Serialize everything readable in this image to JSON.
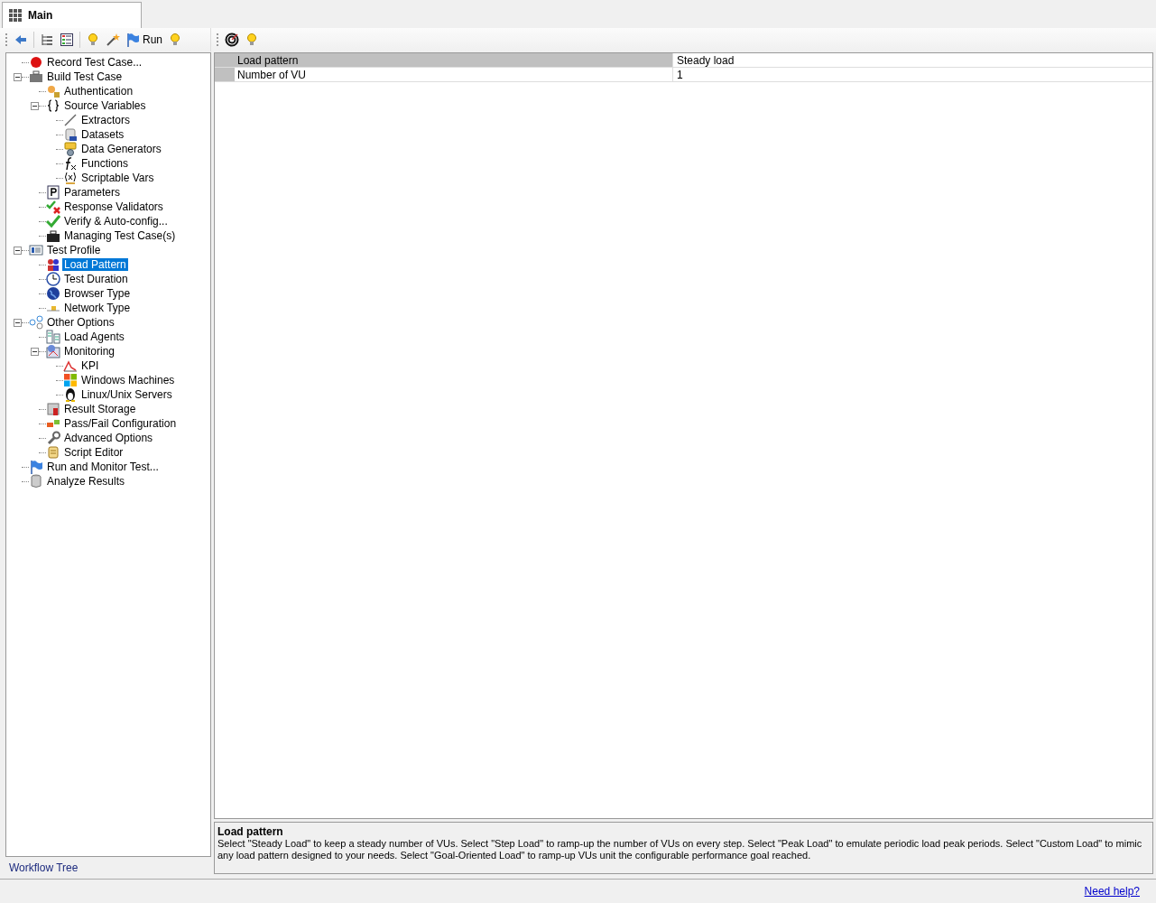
{
  "tabs": [
    {
      "label": "Main",
      "selected": true
    }
  ],
  "toolbar": {
    "run_label": "Run"
  },
  "tree": {
    "title": "Workflow Tree",
    "items": [
      {
        "label": "Record Test Case...",
        "selected": false
      },
      {
        "label": "Build Test Case",
        "selected": false,
        "expanded": true,
        "children": [
          {
            "label": "Authentication",
            "selected": false
          },
          {
            "label": "Source Variables",
            "selected": false,
            "expanded": true,
            "children": [
              {
                "label": "Extractors",
                "selected": false
              },
              {
                "label": "Datasets",
                "selected": false
              },
              {
                "label": "Data Generators",
                "selected": false
              },
              {
                "label": "Functions",
                "selected": false
              },
              {
                "label": "Scriptable Vars",
                "selected": false
              }
            ]
          },
          {
            "label": "Parameters",
            "selected": false
          },
          {
            "label": "Response Validators",
            "selected": false
          },
          {
            "label": "Verify & Auto-config...",
            "selected": false
          },
          {
            "label": "Managing Test Case(s)",
            "selected": false
          }
        ]
      },
      {
        "label": "Test Profile",
        "selected": false,
        "expanded": true,
        "children": [
          {
            "label": "Load Pattern",
            "selected": true
          },
          {
            "label": "Test Duration",
            "selected": false
          },
          {
            "label": "Browser Type",
            "selected": false
          },
          {
            "label": "Network Type",
            "selected": false
          }
        ]
      },
      {
        "label": "Other Options",
        "selected": false,
        "expanded": true,
        "children": [
          {
            "label": "Load Agents",
            "selected": false
          },
          {
            "label": "Monitoring",
            "selected": false,
            "expanded": true,
            "children": [
              {
                "label": "KPI",
                "selected": false
              },
              {
                "label": "Windows Machines",
                "selected": false
              },
              {
                "label": "Linux/Unix Servers",
                "selected": false
              }
            ]
          },
          {
            "label": "Result Storage",
            "selected": false
          },
          {
            "label": "Pass/Fail Configuration",
            "selected": false
          },
          {
            "label": "Advanced Options",
            "selected": false
          },
          {
            "label": "Script Editor",
            "selected": false
          }
        ]
      },
      {
        "label": "Run and Monitor Test...",
        "selected": false
      },
      {
        "label": "Analyze Results",
        "selected": false
      }
    ]
  },
  "properties": [
    {
      "name": "Load pattern",
      "value": "Steady load",
      "selected": true
    },
    {
      "name": "Number of VU",
      "value": "1",
      "selected": false
    }
  ],
  "description": {
    "title": "Load pattern",
    "text": "Select \"Steady Load\" to keep a steady number of VUs. Select \"Step Load\" to ramp-up the number of VUs on every step. Select \"Peak Load\" to emulate periodic load peak periods. Select \"Custom Load\" to mimic any load pattern designed to your needs. Select \"Goal-Oriented Load\" to ramp-up VUs unit the configurable performance goal reached."
  },
  "help_link": "Need help?"
}
